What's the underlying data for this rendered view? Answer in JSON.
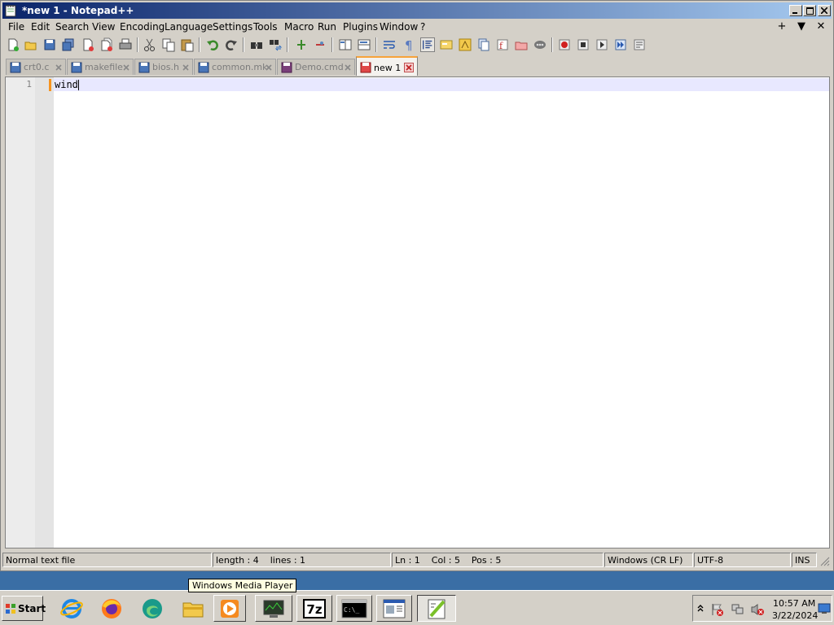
{
  "window": {
    "title": "*new 1 - Notepad++",
    "menu": [
      "File",
      "Edit",
      "Search",
      "View",
      "Encoding",
      "Language",
      "Settings",
      "Tools",
      "Macro",
      "Run",
      "Plugins",
      "Window",
      "?"
    ],
    "menu_right": {
      "add": "+",
      "dropdown": "▼",
      "close": "✕"
    }
  },
  "toolbar": {
    "icons": [
      "new-file-icon",
      "open-file-icon",
      "save-icon",
      "save-all-icon",
      "close-icon",
      "close-all-icon",
      "print-icon",
      "cut-icon",
      "copy-icon",
      "paste-icon",
      "undo-icon",
      "redo-icon",
      "find-icon",
      "replace-icon",
      "zoom-in-icon",
      "zoom-out-icon",
      "sync-vertical-icon",
      "sync-horizontal-icon",
      "word-wrap-icon",
      "show-all-chars-icon",
      "indent-guide-icon",
      "user-language-icon",
      "doc-map-icon",
      "doc-list-icon",
      "function-list-icon",
      "folder-workspace-icon",
      "monitor-icon",
      "record-macro-icon",
      "stop-macro-icon",
      "play-macro-icon",
      "run-macro-multiple-icon",
      "save-macro-icon"
    ]
  },
  "tabs": [
    {
      "label": "crt0.c",
      "active": false
    },
    {
      "label": "makefile",
      "active": false
    },
    {
      "label": "bios.h",
      "active": false
    },
    {
      "label": "common.mk",
      "active": false
    },
    {
      "label": "Demo.cmd",
      "active": false
    },
    {
      "label": "new 1",
      "active": true
    }
  ],
  "editor": {
    "line_number": "1",
    "content": "wind"
  },
  "statusbar": {
    "file_type": "Normal text file",
    "length_lines": "length : 4    lines : 1",
    "position": "Ln : 1    Col : 5    Pos : 5",
    "eol": "Windows (CR LF)",
    "encoding": "UTF-8",
    "mode": "INS"
  },
  "tooltip": "Windows Media Player",
  "taskbar": {
    "start_label": "Start",
    "apps": [
      "internet-explorer-icon",
      "firefox-icon",
      "edge-icon",
      "file-explorer-icon",
      "windows-media-player-icon",
      "network-monitor-icon",
      "7zip-icon",
      "command-prompt-icon",
      "document-viewer-icon",
      "notepad-plus-plus-icon"
    ],
    "sevenzip_text": "7z",
    "cmd_text": "C:\\_",
    "clock_time": "10:57 AM",
    "clock_date": "3/22/2024"
  },
  "colors": {
    "title_start": "#0a246a",
    "title_end": "#a6caf0",
    "active_tab_accent": "#f7a33b",
    "current_line": "#e8e8ff",
    "desktop": "#3a6ea5"
  }
}
